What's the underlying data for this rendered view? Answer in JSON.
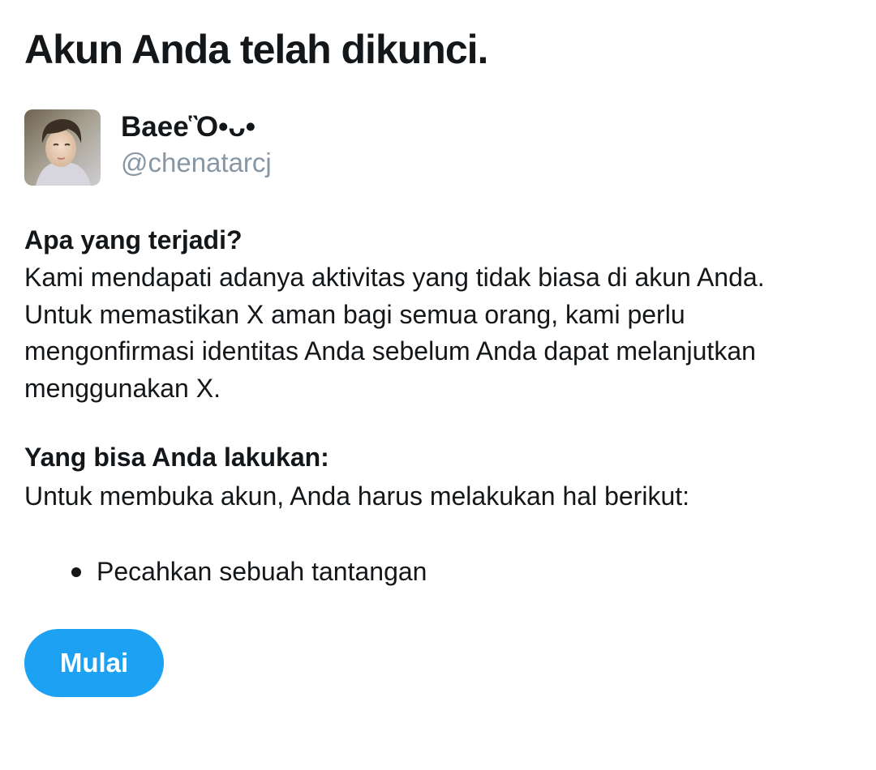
{
  "page": {
    "title": "Akun Anda telah dikunci."
  },
  "user": {
    "display_name": "BaeeὋ•ᴗ•",
    "handle": "@chenatarcj",
    "avatar_icon": "profile-photo"
  },
  "section_what": {
    "heading": "Apa yang terjadi?",
    "body": "Kami mendapati adanya aktivitas yang tidak biasa di akun Anda. Untuk memastikan X aman bagi semua orang, kami perlu mengonfirmasi identitas Anda sebelum Anda dapat melanjutkan menggunakan X."
  },
  "section_can": {
    "heading": "Yang bisa Anda lakukan:",
    "body": "Untuk membuka akun, Anda harus melakukan hal berikut:",
    "items": [
      "Pecahkan sebuah tantangan"
    ]
  },
  "actions": {
    "start_label": "Mulai"
  },
  "colors": {
    "accent": "#1da1f2",
    "text_primary": "#14171a",
    "text_secondary": "#8797a5",
    "background": "#ffffff"
  }
}
